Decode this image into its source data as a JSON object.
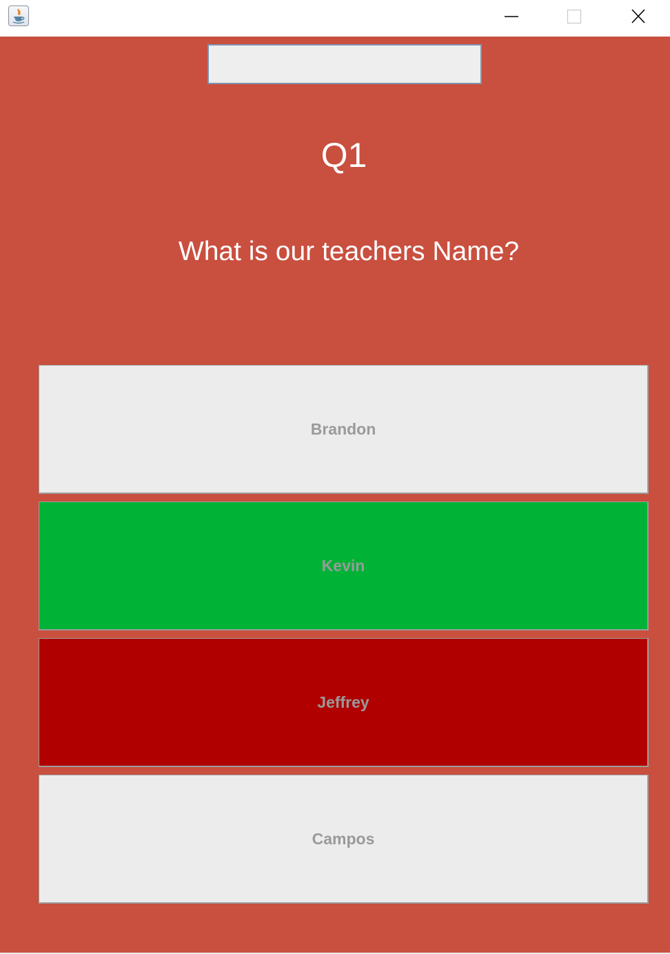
{
  "window": {
    "controls": {
      "minimize_icon": "minimize-icon",
      "maximize_icon": "maximize-icon",
      "close_icon": "close-icon"
    },
    "app_icon": "java-cup-icon"
  },
  "quiz": {
    "input_value": "",
    "question_number": "Q1",
    "question_text": "What is our teachers Name?",
    "answers": [
      {
        "label": "Brandon",
        "color": "#ececec"
      },
      {
        "label": "Kevin",
        "color": "#00b336"
      },
      {
        "label": "Jeffrey",
        "color": "#b00000"
      },
      {
        "label": "Campos",
        "color": "#ececec"
      }
    ]
  },
  "colors": {
    "background": "#c94f3f",
    "text": "#ffffff",
    "answer_text": "#9a9a9a",
    "field_border": "#7f94b2"
  }
}
